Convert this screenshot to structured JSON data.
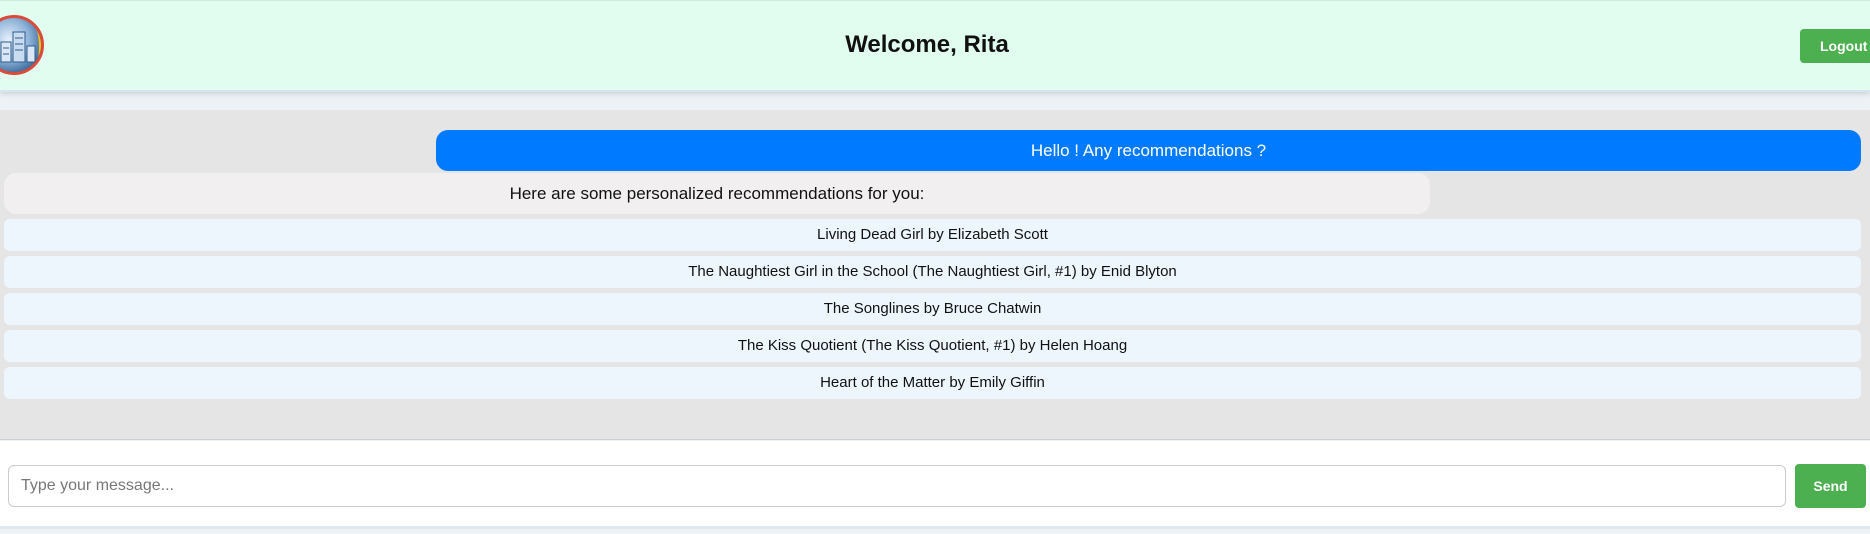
{
  "header": {
    "title": "Welcome, Rita",
    "logout_label": "Logout",
    "logo_icon": "building-logo-icon"
  },
  "chat": {
    "user_message": "Hello ! Any recommendations ?",
    "bot_message": "Here are some personalized recommendations for you:",
    "recommendations": [
      "Living Dead Girl by Elizabeth Scott",
      "The Naughtiest Girl in the School (The Naughtiest Girl, #1) by Enid Blyton",
      "The Songlines by Bruce Chatwin",
      "The Kiss Quotient (The Kiss Quotient, #1) by Helen Hoang",
      "Heart of the Matter by Emily Giffin"
    ]
  },
  "input": {
    "placeholder": "Type your message...",
    "value": "",
    "send_label": "Send"
  },
  "colors": {
    "header_bg": "#e0fdf0",
    "user_bubble": "#007bff",
    "bot_bubble": "#f1eff0",
    "recommendation_bg": "#eef6fd",
    "button_green": "#4caf50"
  }
}
